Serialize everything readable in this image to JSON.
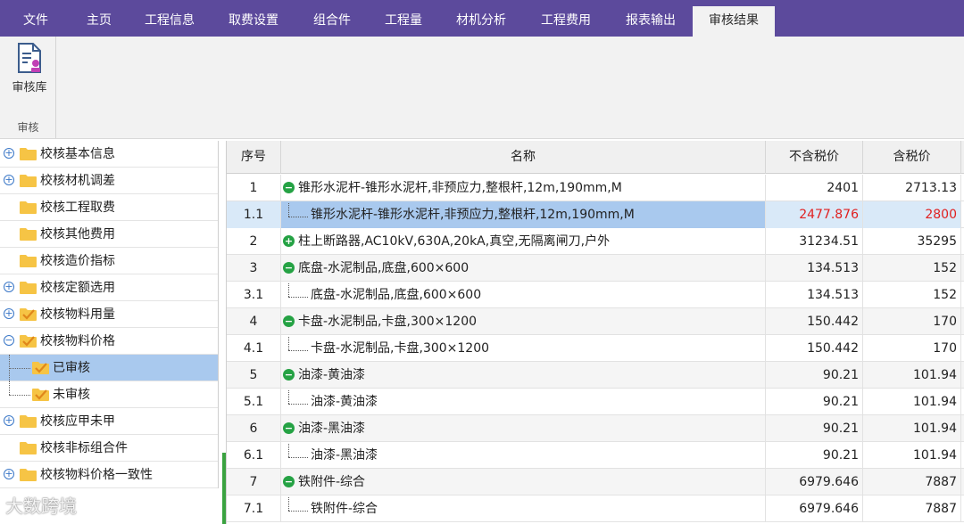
{
  "menu": {
    "items": [
      {
        "label": "文件"
      },
      {
        "label": "主页"
      },
      {
        "label": "工程信息"
      },
      {
        "label": "取费设置"
      },
      {
        "label": "组合件"
      },
      {
        "label": "工程量"
      },
      {
        "label": "材机分析"
      },
      {
        "label": "工程费用"
      },
      {
        "label": "报表输出"
      },
      {
        "label": "审核结果"
      }
    ],
    "active": "审核结果"
  },
  "ribbon": {
    "button_label": "审核库",
    "group_label": "审核"
  },
  "tree": {
    "items": [
      {
        "label": "校核基本信息",
        "expander": "+",
        "checked": false
      },
      {
        "label": "校核材机调差",
        "expander": "+",
        "checked": false
      },
      {
        "label": "校核工程取费",
        "expander": "",
        "checked": false
      },
      {
        "label": "校核其他费用",
        "expander": "",
        "checked": false
      },
      {
        "label": "校核造价指标",
        "expander": "",
        "checked": false
      },
      {
        "label": "校核定额选用",
        "expander": "+",
        "checked": false
      },
      {
        "label": "校核物料用量",
        "expander": "+",
        "checked": true
      },
      {
        "label": "校核物料价格",
        "expander": "−",
        "checked": true
      },
      {
        "label": "已审核",
        "expander": "",
        "checked": true,
        "child": true,
        "selected": true
      },
      {
        "label": "未审核",
        "expander": "",
        "checked": true,
        "child": true
      },
      {
        "label": "校核应甲未甲",
        "expander": "+",
        "checked": false
      },
      {
        "label": "校核非标组合件",
        "expander": "",
        "checked": false
      },
      {
        "label": "校核物料价格一致性",
        "expander": "+",
        "checked": false
      }
    ]
  },
  "table": {
    "headers": {
      "index": "序号",
      "name": "名称",
      "price_ex_tax": "不含税价",
      "price_inc_tax": "含税价"
    },
    "rows": [
      {
        "index": "1",
        "name": "锥形水泥杆-锥形水泥杆,非预应力,整根杆,12m,190mm,M",
        "price_ex_tax": "2401",
        "price_inc_tax": "2713.13",
        "level": "parent",
        "marker": "−"
      },
      {
        "index": "1.1",
        "name": "锥形水泥杆-锥形水泥杆,非预应力,整根杆,12m,190mm,M",
        "price_ex_tax": "2477.876",
        "price_inc_tax": "2800",
        "level": "child",
        "highlight": true
      },
      {
        "index": "2",
        "name": "柱上断路器,AC10kV,630A,20kA,真空,无隔离闸刀,户外",
        "price_ex_tax": "31234.51",
        "price_inc_tax": "35295",
        "level": "parent",
        "marker": "+"
      },
      {
        "index": "3",
        "name": "底盘-水泥制品,底盘,600×600",
        "price_ex_tax": "134.513",
        "price_inc_tax": "152",
        "level": "parent",
        "marker": "−"
      },
      {
        "index": "3.1",
        "name": "底盘-水泥制品,底盘,600×600",
        "price_ex_tax": "134.513",
        "price_inc_tax": "152",
        "level": "child"
      },
      {
        "index": "4",
        "name": "卡盘-水泥制品,卡盘,300×1200",
        "price_ex_tax": "150.442",
        "price_inc_tax": "170",
        "level": "parent",
        "marker": "−"
      },
      {
        "index": "4.1",
        "name": "卡盘-水泥制品,卡盘,300×1200",
        "price_ex_tax": "150.442",
        "price_inc_tax": "170",
        "level": "child"
      },
      {
        "index": "5",
        "name": "油漆-黄油漆",
        "price_ex_tax": "90.21",
        "price_inc_tax": "101.94",
        "level": "parent",
        "marker": "−"
      },
      {
        "index": "5.1",
        "name": "油漆-黄油漆",
        "price_ex_tax": "90.21",
        "price_inc_tax": "101.94",
        "level": "child"
      },
      {
        "index": "6",
        "name": "油漆-黑油漆",
        "price_ex_tax": "90.21",
        "price_inc_tax": "101.94",
        "level": "parent",
        "marker": "−"
      },
      {
        "index": "6.1",
        "name": "油漆-黑油漆",
        "price_ex_tax": "90.21",
        "price_inc_tax": "101.94",
        "level": "child"
      },
      {
        "index": "7",
        "name": "铁附件-综合",
        "price_ex_tax": "6979.646",
        "price_inc_tax": "7887",
        "level": "parent",
        "marker": "−"
      },
      {
        "index": "7.1",
        "name": "铁附件-综合",
        "price_ex_tax": "6979.646",
        "price_inc_tax": "7887",
        "level": "child"
      }
    ]
  },
  "watermark": "大数跨境",
  "colors": {
    "menubar": "#5c4a9c",
    "highlight_text": "#e02020",
    "selection": "#a9c9ee",
    "status_dot": "#25a244",
    "folder": "#f6c445"
  }
}
